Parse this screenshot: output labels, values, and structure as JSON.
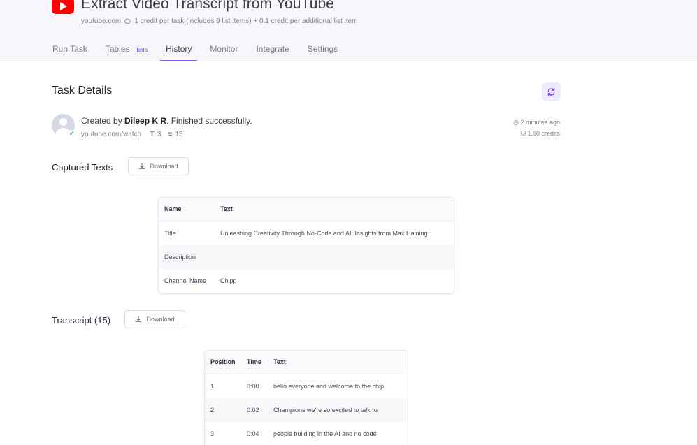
{
  "app": {
    "title": "Extract Video Transcript from YouTube",
    "domain": "youtube.com",
    "pricing": "1 credit per task (includes 9 list items) + 0.1 credit per additional list item"
  },
  "tabs": [
    {
      "label": "Run Task"
    },
    {
      "label": "Tables",
      "badge": "beta"
    },
    {
      "label": "History"
    },
    {
      "label": "Monitor"
    },
    {
      "label": "Integrate"
    },
    {
      "label": "Settings"
    }
  ],
  "task": {
    "heading": "Task Details",
    "created_prefix": "Created by ",
    "user": "Dileep K R",
    "status_text": ". Finished successfully.",
    "url": "youtube.com/watch",
    "text_count": "3",
    "list_count": "15",
    "time_ago": "2 minutes ago",
    "credits": "1.60 credits"
  },
  "captured": {
    "heading": "Captured Texts",
    "download_label": "Download",
    "columns": [
      "Name",
      "Text"
    ],
    "rows": [
      [
        "Title",
        "Unleashing Creativity Through No-Code and AI: Insights from Max Haining"
      ],
      [
        "Description",
        ""
      ],
      [
        "Channel Name",
        "Chipp"
      ]
    ]
  },
  "transcript": {
    "heading": "Transcript (15)",
    "download_label": "Download",
    "columns": [
      "Position",
      "Time",
      "Text"
    ],
    "rows": [
      [
        "1",
        "0:00",
        "hello everyone and welcome to the chip"
      ],
      [
        "2",
        "0:02",
        "Champions we're so excited to talk to"
      ],
      [
        "3",
        "0:04",
        "people building in the AI and no code"
      ]
    ]
  },
  "colors": {
    "brand_red": "#ff0000",
    "accent_purple": "#8b5cf6",
    "success_green": "#16a34a"
  }
}
